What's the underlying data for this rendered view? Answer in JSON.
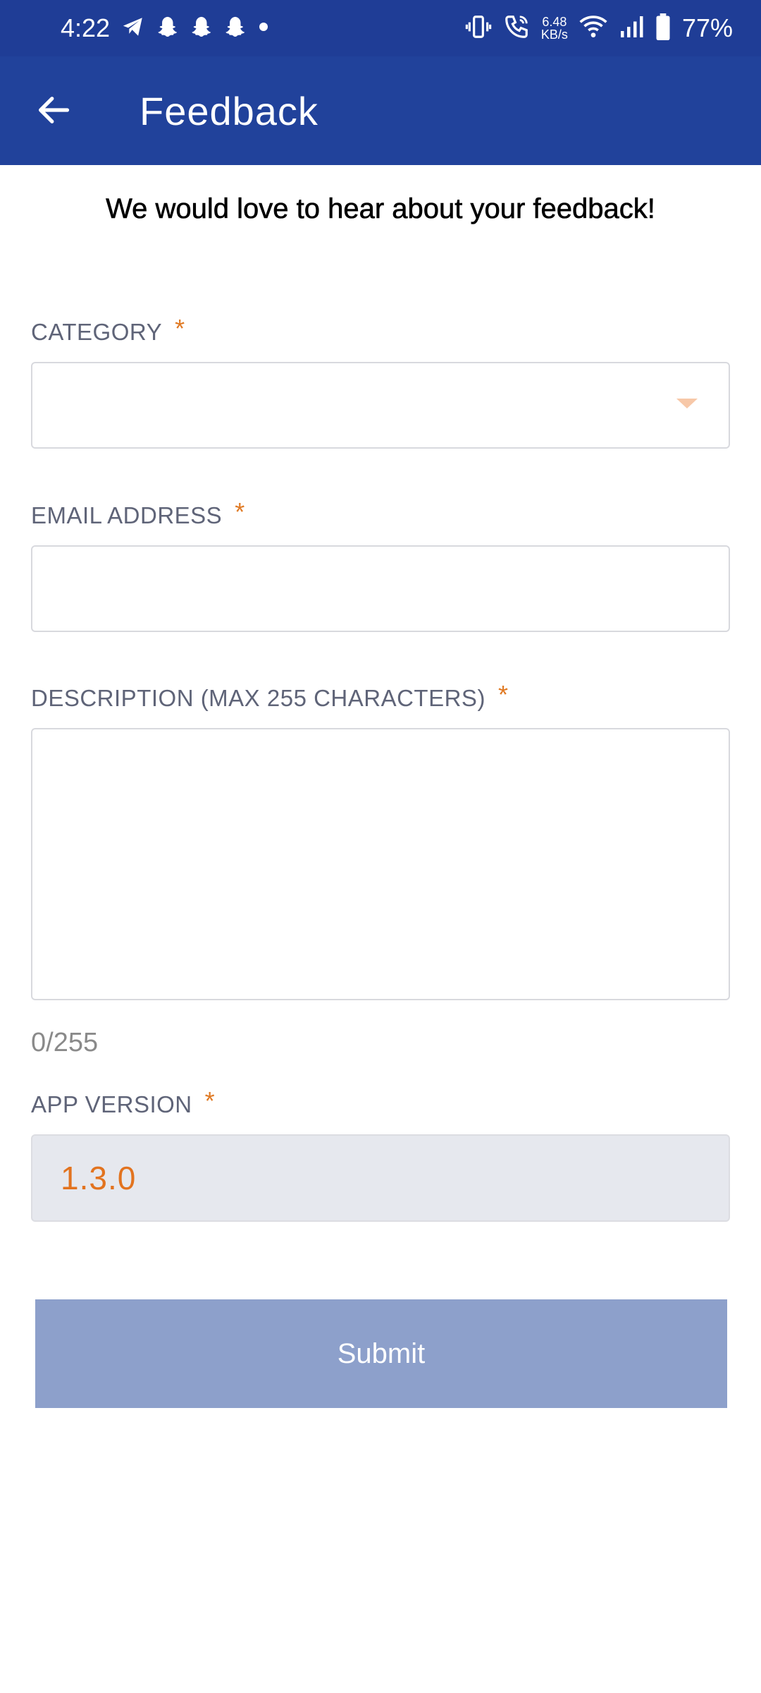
{
  "status_bar": {
    "time": "4:22",
    "net_speed_value": "6.48",
    "net_speed_unit": "KB/s",
    "battery": "77%",
    "left_icons": [
      "telegram-icon",
      "snapchat-icon",
      "snapchat-icon",
      "snapchat-icon",
      "dot-icon"
    ],
    "right_icons": [
      "vibrate-icon",
      "wifi-call-icon",
      "wifi-icon",
      "signal-icon",
      "battery-icon"
    ]
  },
  "app_bar": {
    "title": "Feedback",
    "back_icon": "arrow-left-icon"
  },
  "intro_text": "We would love to hear about your feedback!",
  "form": {
    "category": {
      "label": "CATEGORY",
      "required_mark": "*",
      "value": ""
    },
    "email": {
      "label": "EMAIL ADDRESS",
      "required_mark": "*",
      "value": ""
    },
    "description": {
      "label": "DESCRIPTION (MAX 255 CHARACTERS)",
      "required_mark": "*",
      "value": "",
      "counter": "0/255"
    },
    "app_version": {
      "label": "APP VERSION",
      "required_mark": "*",
      "value": "1.3.0"
    }
  },
  "submit_label": "Submit",
  "colors": {
    "app_bar": "#21429b",
    "status_bar": "#1f3d96",
    "required_accent": "#e07a24",
    "submit_disabled": "#8da0cb"
  }
}
